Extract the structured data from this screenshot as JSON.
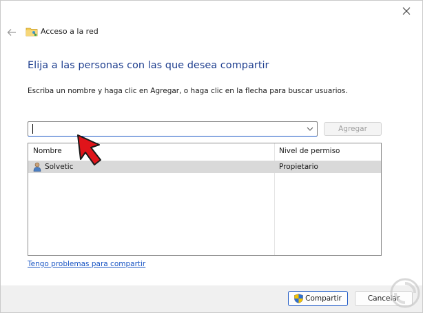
{
  "window": {
    "title": "Acceso a la red",
    "heading": "Elija a las personas con las que desea compartir",
    "instruction": "Escriba un nombre y haga clic en Agregar, o haga clic en la flecha para buscar usuarios."
  },
  "input": {
    "value": "",
    "add_label": "Agregar"
  },
  "table": {
    "columns": [
      "Nombre",
      "Nivel de permiso"
    ],
    "rows": [
      {
        "name": "Solvetic",
        "permission": "Propietario"
      }
    ]
  },
  "link": {
    "text": "Tengo problemas para compartir"
  },
  "footer": {
    "share_label": "Compartir",
    "cancel_label": "Cancelar"
  },
  "icons": {
    "back": "back-arrow-icon",
    "folder": "network-folder-icon",
    "close": "close-icon",
    "dropdown": "chevron-down-icon",
    "user": "user-icon",
    "shield": "uac-shield-icon"
  },
  "colors": {
    "heading": "#1f3f8f",
    "link": "#1a56c4",
    "selected_row": "#d9d9d9",
    "pointer_arrow": "#e0141a"
  }
}
